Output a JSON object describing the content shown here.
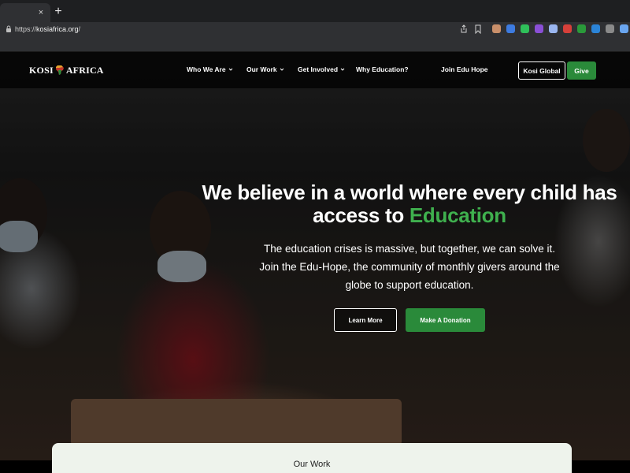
{
  "browser": {
    "url_prefix": "https://",
    "url_host": "kosiafrica.org",
    "url_suffix": "/",
    "tab_close": "×",
    "new_tab": "+",
    "extensions": [
      {
        "icon": "ext-avatar-icon",
        "color": "#c98f6a"
      },
      {
        "icon": "ext-shield-icon",
        "color": "#3d7be0"
      },
      {
        "icon": "ext-green-icon",
        "color": "#2fbf5a"
      },
      {
        "icon": "ext-purple-icon",
        "color": "#8a4fd6"
      },
      {
        "icon": "ext-doc-icon",
        "color": "#9ab6f0"
      },
      {
        "icon": "ext-red-icon",
        "color": "#d6403a"
      },
      {
        "icon": "ext-leaf-icon",
        "color": "#2a9a3a"
      },
      {
        "icon": "ext-blue-icon",
        "color": "#2b84d8"
      },
      {
        "icon": "ext-dark-icon",
        "color": "#8a8a8a"
      },
      {
        "icon": "ext-puzzle-icon",
        "color": "#6aa6f0"
      }
    ]
  },
  "site": {
    "logo_left": "KOSI",
    "logo_right": "AFRICA",
    "nav": [
      {
        "label": "Who We Are",
        "dropdown": true
      },
      {
        "label": "Our Work",
        "dropdown": true
      },
      {
        "label": "Get Involved",
        "dropdown": true
      },
      {
        "label": "Why Education?",
        "dropdown": false
      },
      {
        "label": "Join Edu Hope",
        "dropdown": false
      }
    ],
    "btn_global": "Kosi Global",
    "btn_give": "Give",
    "headline_line1": "We believe in a world where every child has",
    "headline_line2_prefix": "access to ",
    "headline_line2_highlight": "Education",
    "sub_lines": [
      "The education crises is massive, but together, we can solve it.",
      "Join the Edu-Hope, the community of monthly givers around the",
      "globe to support education."
    ],
    "btn_learn": "Learn More",
    "btn_donate": "Make A Donation",
    "section_title": "Our Work",
    "colors": {
      "accent_green": "#2a8a3a",
      "highlight_green": "#3fb04e"
    }
  }
}
